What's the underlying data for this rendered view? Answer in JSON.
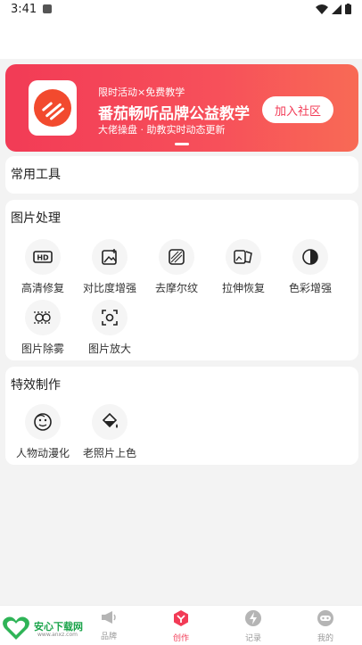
{
  "status_bar": {
    "time": "3:41"
  },
  "banner": {
    "subtitle": "限时活动×免费教学",
    "title": "番茄畅听品牌公益教学",
    "tagline": "大佬操盘 · 助教实时动态更新",
    "join_label": "加入社区"
  },
  "sections": {
    "common": {
      "title": "常用工具"
    },
    "image": {
      "title": "图片处理",
      "tools": [
        {
          "label": "高清修复",
          "icon": "hd-icon"
        },
        {
          "label": "对比度增强",
          "icon": "image-plus-icon"
        },
        {
          "label": "去摩尔纹",
          "icon": "moire-icon"
        },
        {
          "label": "拉伸恢复",
          "icon": "stretch-image-icon"
        },
        {
          "label": "色彩增强",
          "icon": "contrast-circle-icon"
        },
        {
          "label": "图片除雾",
          "icon": "dehaze-icon"
        },
        {
          "label": "图片放大",
          "icon": "zoom-frame-icon"
        }
      ]
    },
    "effects": {
      "title": "特效制作",
      "tools": [
        {
          "label": "人物动漫化",
          "icon": "face-icon"
        },
        {
          "label": "老照片上色",
          "icon": "paint-bucket-icon"
        }
      ]
    }
  },
  "nav": {
    "items": [
      {
        "label": "品牌",
        "icon": "megaphone-icon"
      },
      {
        "label": "创作",
        "icon": "create-icon"
      },
      {
        "label": "记录",
        "icon": "bolt-icon"
      },
      {
        "label": "我的",
        "icon": "robot-face-icon"
      }
    ],
    "active_index": 1
  },
  "watermark": {
    "brand": "安心下载网",
    "url": "www.anxz.com"
  },
  "colors": {
    "accent": "#f23b56",
    "background": "#f3f3f3"
  }
}
